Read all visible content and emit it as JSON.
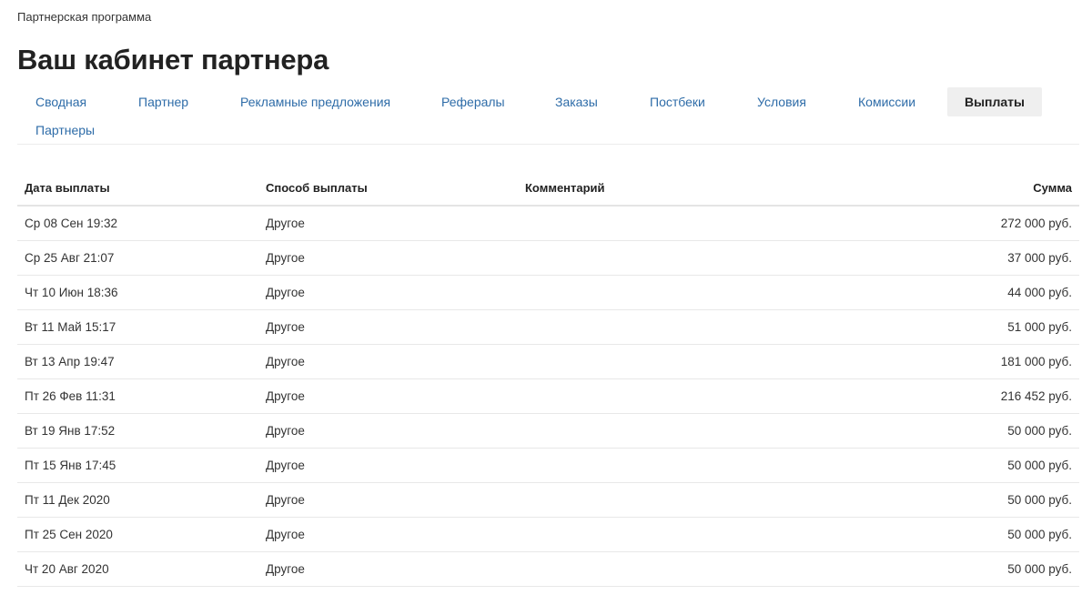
{
  "breadcrumb": "Партнерская программа",
  "title": "Ваш кабинет партнера",
  "tabs": [
    {
      "label": "Сводная"
    },
    {
      "label": "Партнер"
    },
    {
      "label": "Рекламные предложения"
    },
    {
      "label": "Рефералы"
    },
    {
      "label": "Заказы"
    },
    {
      "label": "Постбеки"
    },
    {
      "label": "Условия"
    },
    {
      "label": "Комиссии"
    },
    {
      "label": "Выплаты",
      "active": true
    },
    {
      "label": "Партнеры"
    }
  ],
  "table": {
    "headers": {
      "date": "Дата выплаты",
      "method": "Способ выплаты",
      "comment": "Комментарий",
      "amount": "Сумма"
    },
    "rows": [
      {
        "date": "Ср 08 Сен 19:32",
        "method": "Другое",
        "comment": "",
        "amount": "272 000 руб."
      },
      {
        "date": "Ср 25 Авг 21:07",
        "method": "Другое",
        "comment": "",
        "amount": "37 000 руб."
      },
      {
        "date": "Чт 10 Июн 18:36",
        "method": "Другое",
        "comment": "",
        "amount": "44 000 руб."
      },
      {
        "date": "Вт 11 Май 15:17",
        "method": "Другое",
        "comment": "",
        "amount": "51 000 руб."
      },
      {
        "date": "Вт 13 Апр 19:47",
        "method": "Другое",
        "comment": "",
        "amount": "181 000 руб."
      },
      {
        "date": "Пт 26 Фев 11:31",
        "method": "Другое",
        "comment": "",
        "amount": "216 452 руб."
      },
      {
        "date": "Вт 19 Янв 17:52",
        "method": "Другое",
        "comment": "",
        "amount": "50 000 руб."
      },
      {
        "date": "Пт 15 Янв 17:45",
        "method": "Другое",
        "comment": "",
        "amount": "50 000 руб."
      },
      {
        "date": "Пт 11 Дек 2020",
        "method": "Другое",
        "comment": "",
        "amount": "50 000 руб."
      },
      {
        "date": "Пт 25 Сен 2020",
        "method": "Другое",
        "comment": "",
        "amount": "50 000 руб."
      },
      {
        "date": "Чт 20 Авг 2020",
        "method": "Другое",
        "comment": "",
        "amount": "50 000 руб."
      }
    ]
  },
  "colors": {
    "link": "#2e6ca8",
    "active_tab_bg": "#efefef",
    "text": "#222222"
  }
}
